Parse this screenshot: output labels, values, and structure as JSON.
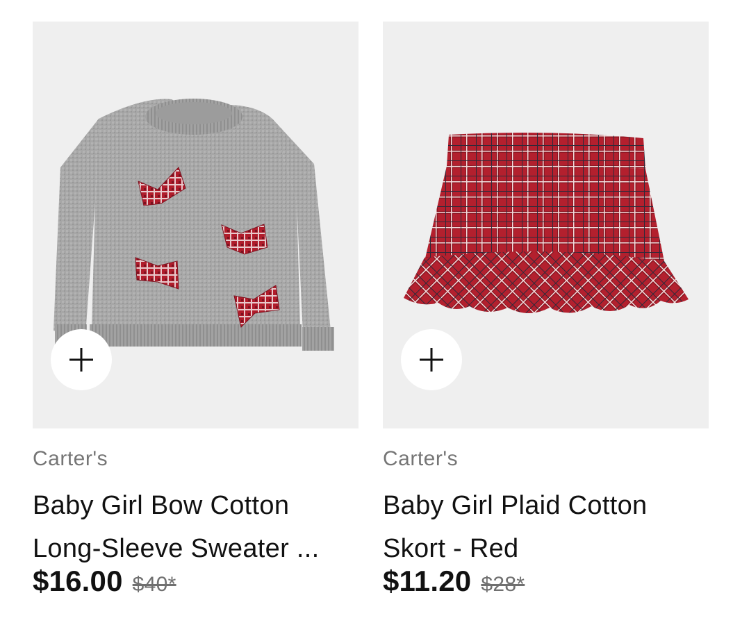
{
  "products": [
    {
      "brand": "Carter's",
      "title_line1": "Baby Girl Bow Cotton",
      "title_line2": "Long-Sleeve Sweater ...",
      "price": "$16.00",
      "original_price": "$40*",
      "image": "gray-sweater-with-red-plaid-bows",
      "add_icon": "plus-icon"
    },
    {
      "brand": "Carter's",
      "title_line1": "Baby Girl Plaid Cotton",
      "title_line2": "Skort - Red",
      "price": "$11.20",
      "original_price": "$28*",
      "image": "red-plaid-skort",
      "add_icon": "plus-icon"
    }
  ],
  "colors": {
    "image_background": "#efefef",
    "sweater_gray": "#a9a9a9",
    "plaid_red": "#b3202e",
    "brand_text": "#757575",
    "strikethrough_text": "#707070"
  }
}
